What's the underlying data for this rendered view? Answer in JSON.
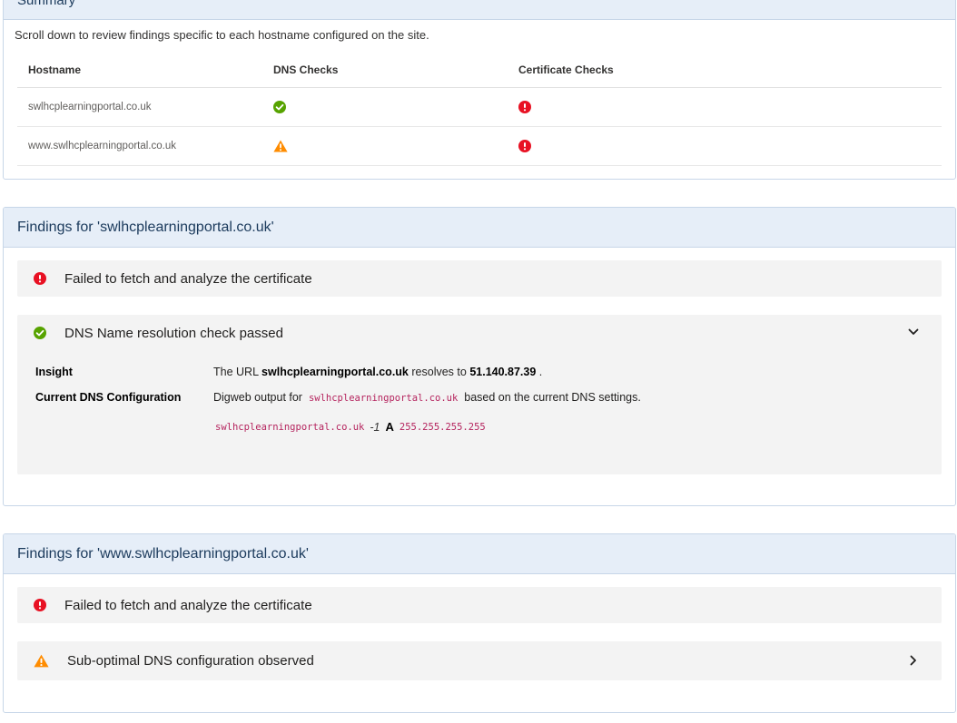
{
  "summary": {
    "title": "Summary",
    "intro": "Scroll down to review findings specific to each hostname configured on the site.",
    "headers": {
      "hostname": "Hostname",
      "dns": "DNS Checks",
      "cert": "Certificate Checks"
    },
    "rows": [
      {
        "hostname": "swlhcplearningportal.co.uk",
        "dns": "success-icon",
        "cert": "error-icon"
      },
      {
        "hostname": "www.swlhcplearningportal.co.uk",
        "dns": "warning-icon",
        "cert": "error-icon"
      }
    ]
  },
  "findings1": {
    "title": "Findings for 'swlhcplearningportal.co.uk'",
    "cert_item": "Failed to fetch and analyze the certificate",
    "dns_item": "DNS Name resolution check passed",
    "insight_label": "Insight",
    "insight_pre": "The URL",
    "insight_host": "swlhcplearningportal.co.uk",
    "insight_mid": "resolves to",
    "insight_ip": "51.140.87.39",
    "insight_post": ".",
    "config_label": "Current DNS Configuration",
    "config_pre": "Digweb output for",
    "config_host": "swlhcplearningportal.co.uk",
    "config_post": "based on the current DNS settings.",
    "record_host": "swlhcplearningportal.co.uk",
    "record_ttl": "-1",
    "record_type": "A",
    "record_value": "255.255.255.255"
  },
  "findings2": {
    "title": "Findings for 'www.swlhcplearningportal.co.uk'",
    "cert_item": "Failed to fetch and analyze the certificate",
    "dns_item": "Sub-optimal DNS configuration observed"
  },
  "colors": {
    "error": "#e81123",
    "success": "#57a300",
    "warning": "#ff8c00",
    "header_bg": "#e6eef8"
  }
}
